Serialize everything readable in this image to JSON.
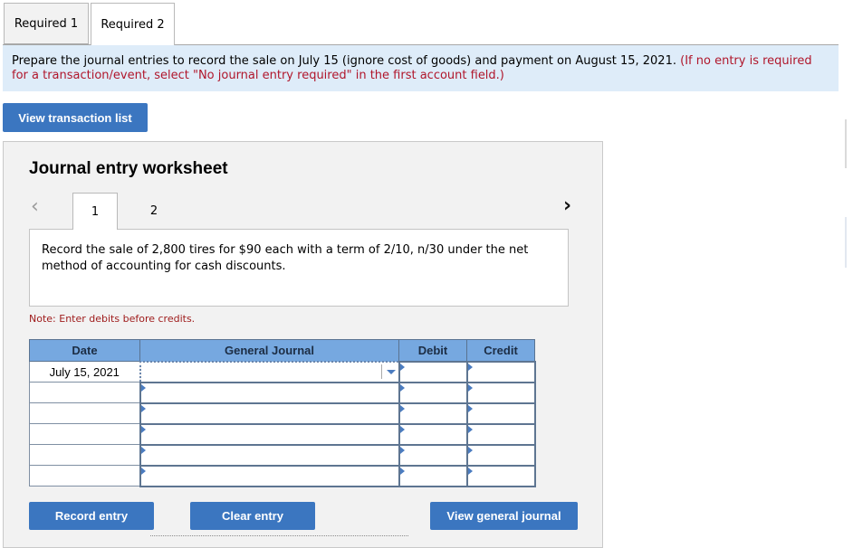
{
  "tabs": [
    {
      "label": "Required 1",
      "active": false
    },
    {
      "label": "Required 2",
      "active": true
    }
  ],
  "instruction": {
    "text": "Prepare the journal entries to record the sale on July 15 (ignore cost of goods) and payment on August 15, 2021.",
    "note": "(If no entry is required for a transaction/event, select \"No journal entry required\" in the first account field.)"
  },
  "view_transaction_list_label": "View transaction list",
  "worksheet": {
    "title": "Journal entry worksheet",
    "prev_icon": "chevron-left-icon",
    "next_icon": "chevron-right-icon",
    "pages": [
      {
        "label": "1",
        "active": true
      },
      {
        "label": "2",
        "active": false
      }
    ],
    "description": "Record the sale of 2,800 tires for $90 each with a term of 2/10, n/30 under the net method of accounting for cash discounts.",
    "note": "Note: Enter debits before credits.",
    "table": {
      "headers": [
        "Date",
        "General Journal",
        "Debit",
        "Credit"
      ],
      "rows": [
        {
          "date": "July 15, 2021",
          "account": "",
          "debit": "",
          "credit": ""
        },
        {
          "date": "",
          "account": "",
          "debit": "",
          "credit": ""
        },
        {
          "date": "",
          "account": "",
          "debit": "",
          "credit": ""
        },
        {
          "date": "",
          "account": "",
          "debit": "",
          "credit": ""
        },
        {
          "date": "",
          "account": "",
          "debit": "",
          "credit": ""
        },
        {
          "date": "",
          "account": "",
          "debit": "",
          "credit": ""
        }
      ]
    },
    "buttons": {
      "record": "Record entry",
      "clear": "Clear entry",
      "view_general_journal": "View general journal"
    }
  },
  "colors": {
    "button": "#3b76c0",
    "header": "#76a8e0",
    "instruction_bg": "#deecf9",
    "note_red": "#b0162b"
  }
}
